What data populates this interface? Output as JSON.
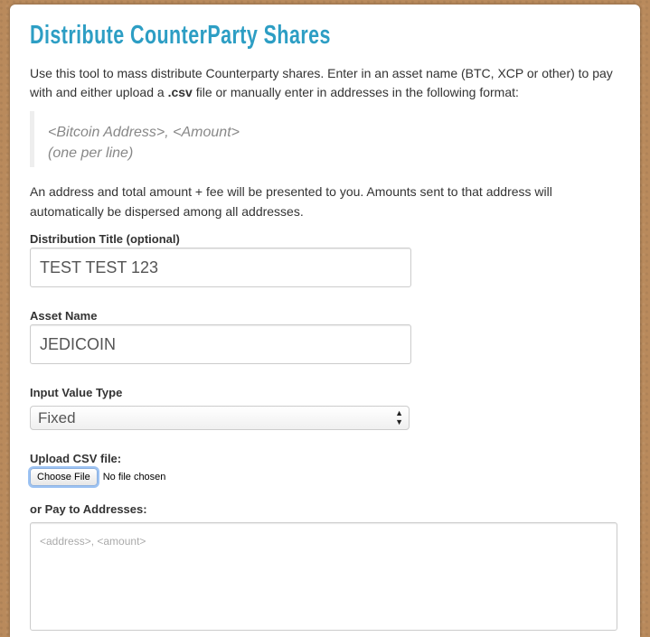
{
  "title": "Distribute CounterParty Shares",
  "intro": {
    "part1": "Use this tool to mass distribute Counterparty shares. Enter in an asset name (BTC, XCP or other) to pay with and either upload a ",
    "bold": ".csv",
    "part2": " file or manually enter in addresses in the following format:"
  },
  "format": {
    "line1": "<Bitcoin Address>, <Amount>",
    "line2": "(one per line)"
  },
  "note": "An address and total amount + fee will be presented to you. Amounts sent to that address will automatically be dispersed among all addresses.",
  "form": {
    "distribution_title_label": "Distribution Title (optional)",
    "distribution_title_value": "TEST TEST 123",
    "asset_name_label": "Asset Name",
    "asset_name_value": "JEDICOIN",
    "input_value_type_label": "Input Value Type",
    "input_value_type_selected": "Fixed",
    "upload_csv_label": "Upload CSV file:",
    "choose_file_button": "Choose File",
    "no_file_text": "No file chosen",
    "pay_to_label": "or Pay to Addresses:",
    "pay_to_placeholder": "<address>, <amount>"
  }
}
